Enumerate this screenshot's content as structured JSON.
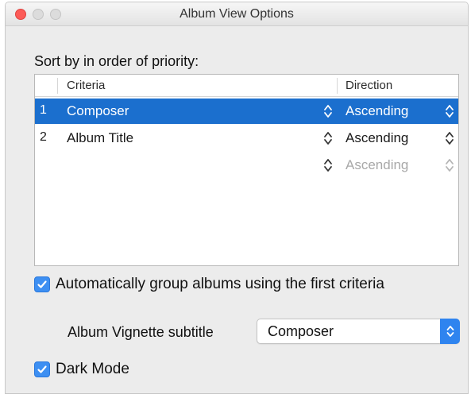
{
  "window": {
    "title": "Album View Options"
  },
  "sort": {
    "heading": "Sort by in order of priority:",
    "columns": {
      "criteria": "Criteria",
      "direction": "Direction"
    },
    "rows": [
      {
        "num": "1",
        "criteria": "Composer",
        "direction": "Ascending",
        "selected": true
      },
      {
        "num": "2",
        "criteria": "Album Title",
        "direction": "Ascending",
        "selected": false
      },
      {
        "num": "",
        "criteria": "",
        "direction": "Ascending",
        "selected": false,
        "disabled": true
      }
    ]
  },
  "options": {
    "auto_group_label": "Automatically group albums using the first criteria",
    "auto_group_checked": true,
    "vignette_label": "Album Vignette subtitle",
    "vignette_value": "Composer",
    "dark_mode_label": "Dark Mode",
    "dark_mode_checked": true
  },
  "colors": {
    "selection": "#1b6fce",
    "accent": "#3d8ff2",
    "close_button": "#fc5b57"
  },
  "icons": {
    "stepper": "up-down-chevron-icon",
    "checkmark": "checkmark-icon"
  }
}
